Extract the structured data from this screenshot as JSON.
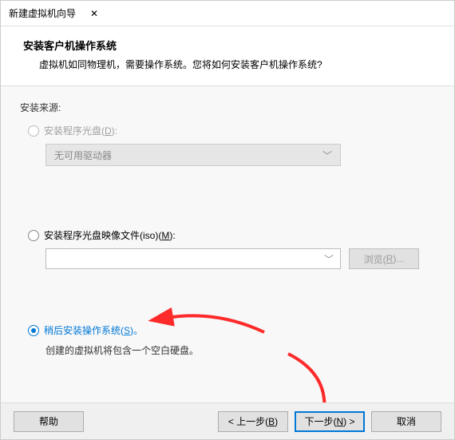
{
  "titlebar": {
    "title": "新建虚拟机向导",
    "close": "✕"
  },
  "header": {
    "title": "安装客户机操作系统",
    "sub": "虚拟机如同物理机，需要操作系统。您将如何安装客户机操作系统?"
  },
  "content": {
    "source_label": "安装来源:",
    "option_disc": {
      "pre": "安装程序光盘(",
      "hot": "D",
      "post": "):"
    },
    "drive_dropdown": "无可用驱动器",
    "option_iso": {
      "pre": "安装程序光盘映像文件(iso)(",
      "hot": "M",
      "post": "):"
    },
    "browse": {
      "pre": "浏览(",
      "hot": "R",
      "post": ")..."
    },
    "option_later": {
      "pre": "稍后安装操作系统(",
      "hot": "S",
      "post": ")。"
    },
    "later_hint": "创建的虚拟机将包含一个空白硬盘。"
  },
  "footer": {
    "help": "帮助",
    "back": {
      "pre": "< 上一步(",
      "hot": "B",
      "post": ")"
    },
    "next": {
      "pre": "下一步(",
      "hot": "N",
      "post": ") >"
    },
    "cancel": "取消"
  },
  "icons": {
    "chevron": "﹀"
  },
  "colors": {
    "accent": "#0078d7",
    "arrow": "#ff2a2a"
  }
}
